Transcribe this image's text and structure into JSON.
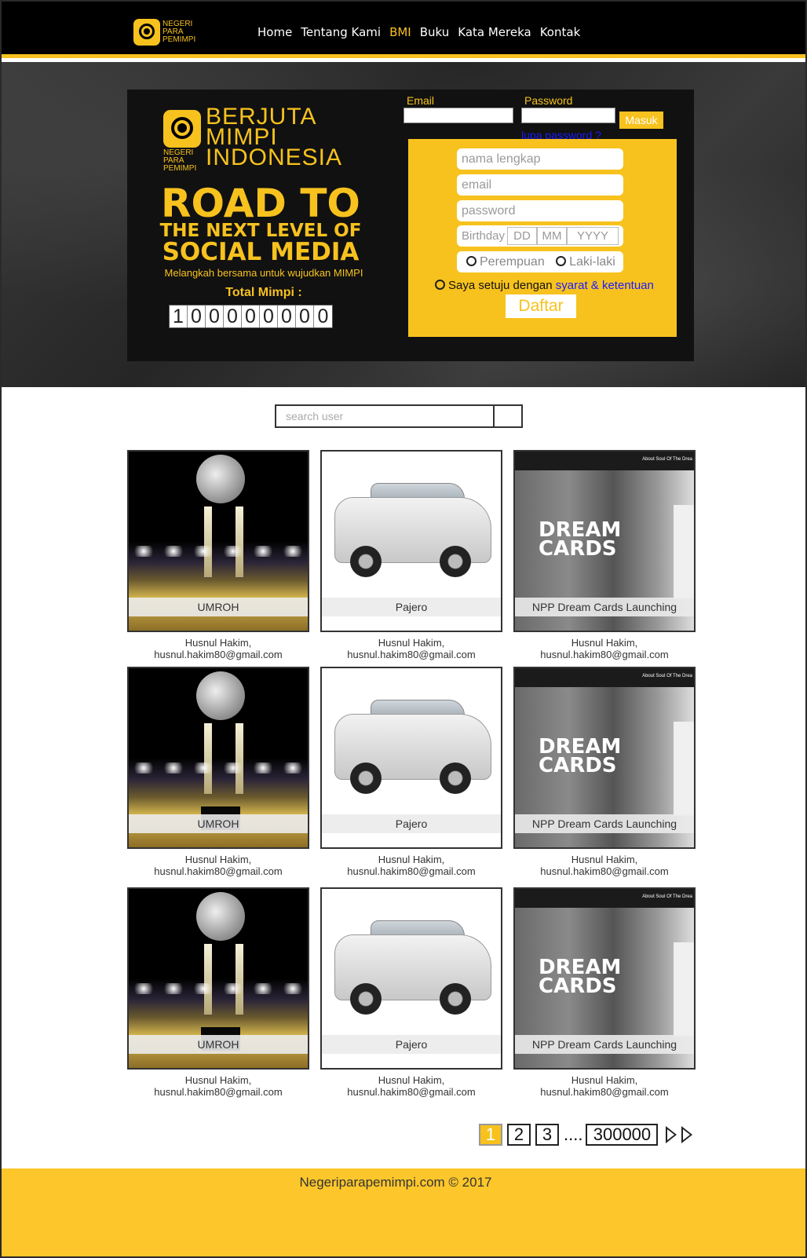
{
  "logo": {
    "line1": "NEGERI",
    "line2": "PARA",
    "line3": "PEMIMPI"
  },
  "nav": {
    "items": [
      "Home",
      "Tentang Kami",
      "BMI",
      "Buku",
      "Kata Mereka",
      "Kontak"
    ],
    "active": "BMI"
  },
  "hero": {
    "brand": {
      "line1": "BERJUTA",
      "line2": "MIMPI",
      "line3": "INDONESIA",
      "small1": "NEGERI",
      "small2": "PARA",
      "small3": "PEMIMPI"
    },
    "headline1": "ROAD TO",
    "headline2": "THE NEXT LEVEL OF",
    "headline3": "SOCIAL MEDIA",
    "tagline": "Melangkah bersama untuk wujudkan MIMPI",
    "total_label": "Total Mimpi :",
    "counter_digits": [
      "1",
      "0",
      "0",
      "0",
      "0",
      "0",
      "0",
      "0",
      "0"
    ]
  },
  "login": {
    "email_label": "Email",
    "password_label": "Password",
    "submit": "Masuk",
    "forgot": "lupa password ?"
  },
  "register": {
    "name_placeholder": "nama lengkap",
    "email_placeholder": "email",
    "password_placeholder": "password",
    "birthday_label": "Birthday",
    "dd": "DD",
    "mm": "MM",
    "yyyy": "YYYY",
    "gender_female": "Perempuan",
    "gender_male": "Laki-laki",
    "agree_text": "Saya setuju dengan",
    "agree_link": "syarat & ketentuan",
    "submit": "Daftar"
  },
  "search": {
    "placeholder": "search user"
  },
  "cards": [
    {
      "title": "UMROH",
      "author": "Husnul Hakim,",
      "email": "husnul.hakim80@gmail.com"
    },
    {
      "title": "Pajero",
      "author": "Husnul Hakim,",
      "email": "husnul.hakim80@gmail.com"
    },
    {
      "title": "NPP Dream Cards Launching",
      "author": "Husnul Hakim,",
      "email": "husnul.hakim80@gmail.com"
    },
    {
      "title": "UMROH",
      "author": "Husnul Hakim,",
      "email": "husnul.hakim80@gmail.com"
    },
    {
      "title": "Pajero",
      "author": "Husnul Hakim,",
      "email": "husnul.hakim80@gmail.com"
    },
    {
      "title": "NPP Dream Cards Launching",
      "author": "Husnul Hakim,",
      "email": "husnul.hakim80@gmail.com"
    },
    {
      "title": "UMROH",
      "author": "Husnul Hakim,",
      "email": "husnul.hakim80@gmail.com"
    },
    {
      "title": "Pajero",
      "author": "Husnul Hakim,",
      "email": "husnul.hakim80@gmail.com"
    },
    {
      "title": "NPP Dream Cards Launching",
      "author": "Husnul Hakim,",
      "email": "husnul.hakim80@gmail.com"
    }
  ],
  "dream_card": {
    "header": "About  Soul Of The Drea",
    "text1": "DREAM",
    "text2": "CARDS"
  },
  "pager": {
    "pages": [
      "1",
      "2",
      "3"
    ],
    "ellipsis": "....",
    "last": "300000",
    "current": "1"
  },
  "footer": {
    "text": "Negeriparapemimpi.com © 2017"
  },
  "colors": {
    "accent": "#f7c21e",
    "nav_bg": "#000000",
    "link": "#1a1aff",
    "footer_bg": "#fdc72b"
  }
}
